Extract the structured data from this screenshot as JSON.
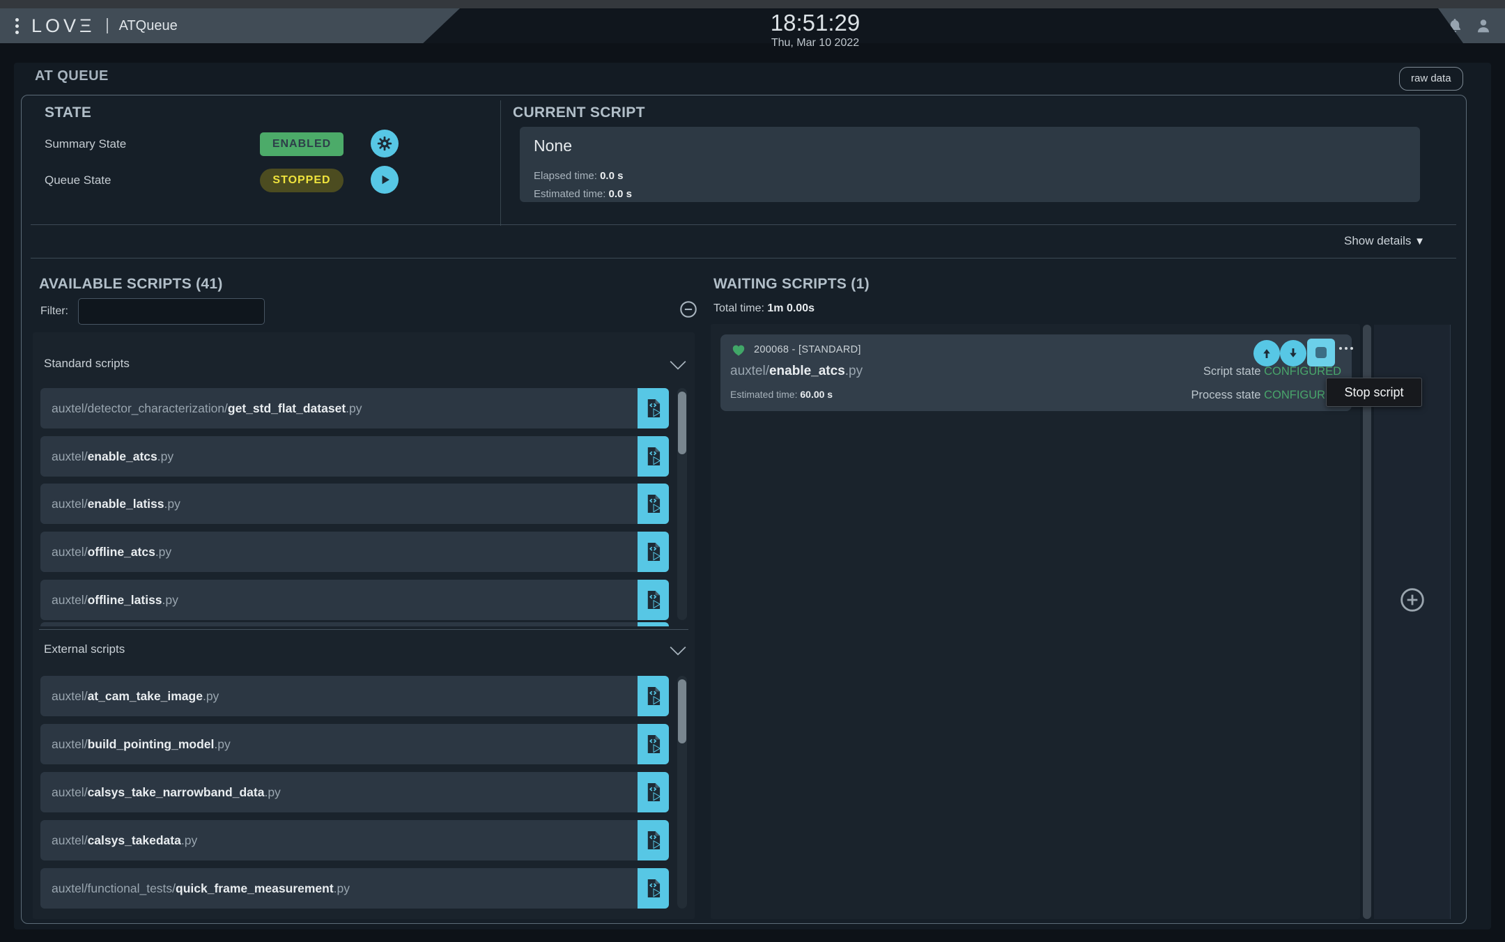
{
  "header": {
    "logo_text": "LOVΞ",
    "app_name": "ATQueue",
    "time": "18:51:29",
    "date": "Thu, Mar 10 2022"
  },
  "panel": {
    "title": "AT QUEUE",
    "raw_data_button": "raw data",
    "show_details": "Show details",
    "show_details_arrow": "▼"
  },
  "state": {
    "heading": "STATE",
    "summary_label": "Summary State",
    "summary_value": "ENABLED",
    "queue_label": "Queue State",
    "queue_value": "STOPPED"
  },
  "current_script": {
    "heading": "CURRENT SCRIPT",
    "name": "None",
    "elapsed_label": "Elapsed time:",
    "elapsed_value": "0.0 s",
    "estimated_label": "Estimated time:",
    "estimated_value": "0.0 s"
  },
  "available": {
    "heading": "AVAILABLE SCRIPTS (41)",
    "filter_label": "Filter:",
    "filter_value": "",
    "groups": [
      {
        "label": "Standard scripts",
        "scripts": [
          {
            "prefix": "auxtel/detector_characterization/",
            "name": "get_std_flat_dataset",
            "ext": ".py"
          },
          {
            "prefix": "auxtel/",
            "name": "enable_atcs",
            "ext": ".py"
          },
          {
            "prefix": "auxtel/",
            "name": "enable_latiss",
            "ext": ".py"
          },
          {
            "prefix": "auxtel/",
            "name": "offline_atcs",
            "ext": ".py"
          },
          {
            "prefix": "auxtel/",
            "name": "offline_latiss",
            "ext": ".py"
          }
        ]
      },
      {
        "label": "External scripts",
        "scripts": [
          {
            "prefix": "auxtel/",
            "name": "at_cam_take_image",
            "ext": ".py"
          },
          {
            "prefix": "auxtel/",
            "name": "build_pointing_model",
            "ext": ".py"
          },
          {
            "prefix": "auxtel/",
            "name": "calsys_take_narrowband_data",
            "ext": ".py"
          },
          {
            "prefix": "auxtel/",
            "name": "calsys_takedata",
            "ext": ".py"
          },
          {
            "prefix": "auxtel/functional_tests/",
            "name": "quick_frame_measurement",
            "ext": ".py"
          }
        ]
      }
    ]
  },
  "waiting": {
    "heading": "WAITING SCRIPTS (1)",
    "total_label": "Total time:",
    "total_value": "1m 0.00s",
    "card": {
      "id": "200068",
      "separator": "-",
      "type": "[STANDARD]",
      "prefix": "auxtel/",
      "name": "enable_atcs",
      "ext": ".py",
      "estimated_label": "Estimated time:",
      "estimated_value": "60.00 s",
      "script_state_label": "Script state",
      "script_state_value": "CONFIGURED",
      "process_state_label": "Process state",
      "process_state_value": "CONFIGURED"
    }
  },
  "tooltip": {
    "text": "Stop script"
  },
  "colors": {
    "accent_cyan": "#57c7e5",
    "enabled_badge_bg": "#4cab69",
    "stopped_badge_bg": "#4c4c20",
    "stopped_badge_text": "#efe33d",
    "configured_text": "#49a56b",
    "heart_green": "#41a768"
  }
}
